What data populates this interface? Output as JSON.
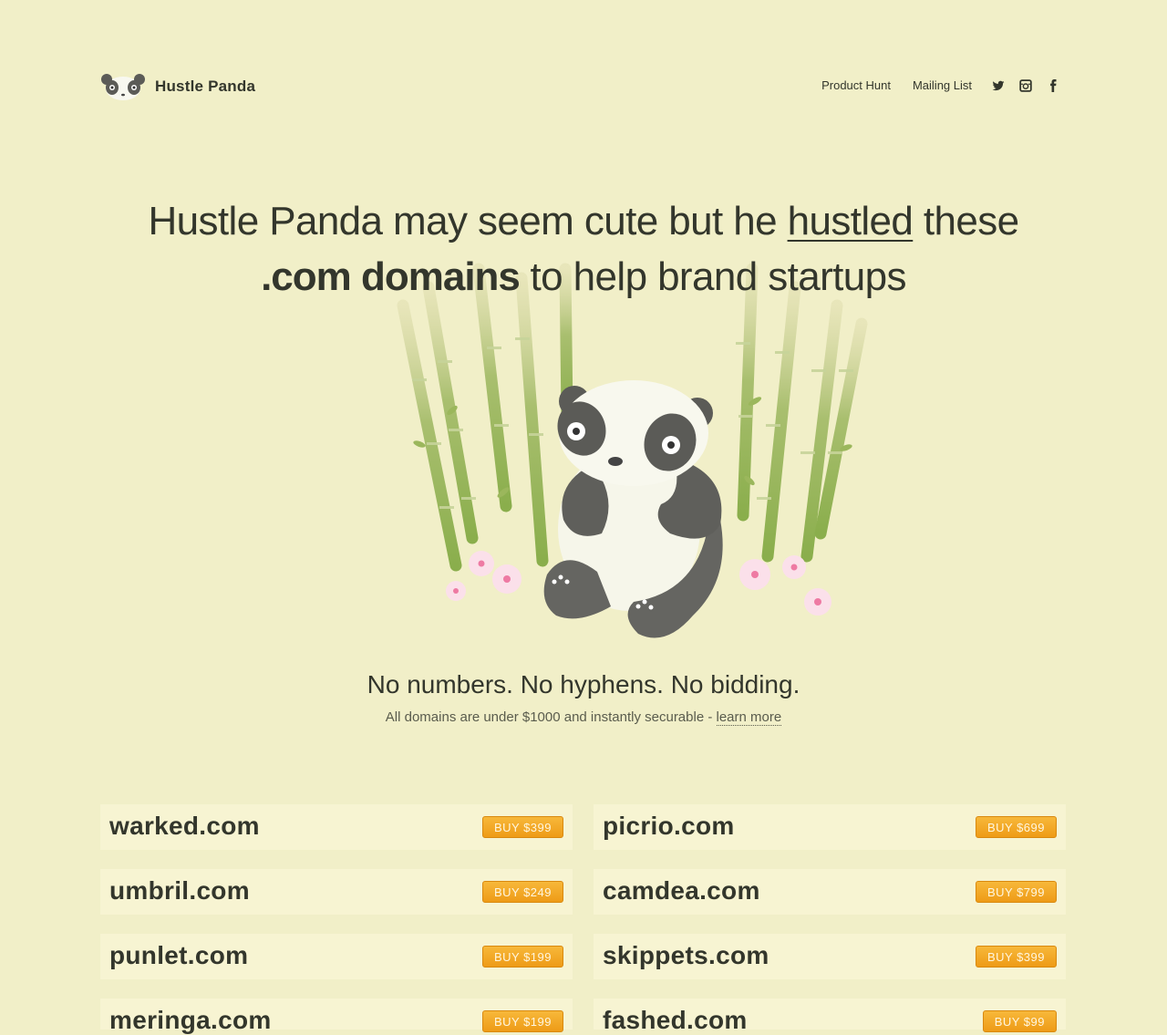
{
  "brand": {
    "name": "Hustle Panda"
  },
  "nav": {
    "links": [
      "Product Hunt",
      "Mailing List"
    ],
    "social_icons": [
      "twitter-icon",
      "instagram-icon",
      "facebook-icon"
    ]
  },
  "hero": {
    "line1_pre": "Hustle Panda may seem cute but he ",
    "line1_link": "hustled",
    "line1_post": " these",
    "line2_bold": ".com domains",
    "line2_post": " to help brand startups"
  },
  "tagline": "No numbers. No hyphens. No bidding.",
  "subtag": {
    "text": "All domains are under $1000 and instantly securable - ",
    "link": "learn more"
  },
  "domains": [
    {
      "name": "warked.com",
      "buy": "BUY $399"
    },
    {
      "name": "picrio.com",
      "buy": "BUY $699"
    },
    {
      "name": "umbril.com",
      "buy": "BUY $249"
    },
    {
      "name": "camdea.com",
      "buy": "BUY $799"
    },
    {
      "name": "punlet.com",
      "buy": "BUY $199"
    },
    {
      "name": "skippets.com",
      "buy": "BUY $399"
    },
    {
      "name": "meringa.com",
      "buy": "BUY $199"
    },
    {
      "name": "fashed.com",
      "buy": "BUY $99"
    }
  ],
  "colors": {
    "background": "#f1efc8",
    "card": "#f7f4d2",
    "button": "#f2a929",
    "text": "#33362c"
  }
}
